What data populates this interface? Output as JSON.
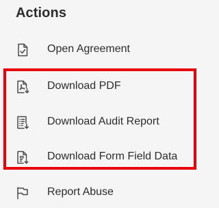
{
  "panel": {
    "title": "Actions",
    "items": [
      {
        "label": "Open Agreement",
        "icon": "document-check-icon"
      },
      {
        "label": "Download PDF",
        "icon": "pdf-download-icon"
      },
      {
        "label": "Download Audit Report",
        "icon": "audit-report-download-icon"
      },
      {
        "label": "Download Form Field Data",
        "icon": "form-data-download-icon"
      },
      {
        "label": "Report Abuse",
        "icon": "flag-icon"
      }
    ]
  },
  "highlight": {
    "color": "#e8000b"
  }
}
